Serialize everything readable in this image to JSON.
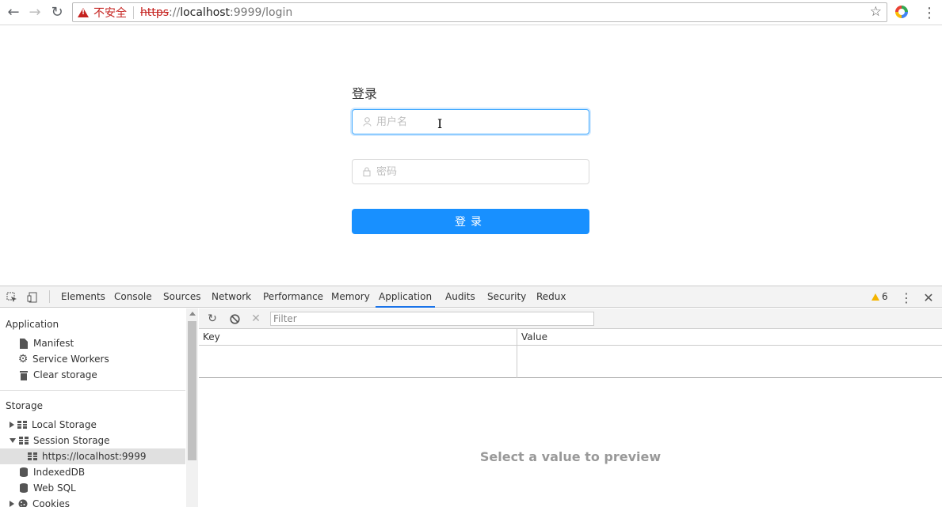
{
  "browser": {
    "security_label": "不安全",
    "url_scheme": "https",
    "url_sep": "://",
    "url_host": "localhost",
    "url_rest": ":9999/login"
  },
  "login": {
    "title": "登录",
    "username_placeholder": "用户名",
    "password_placeholder": "密码",
    "submit_label": "登录"
  },
  "devtools": {
    "tabs": [
      "Elements",
      "Console",
      "Sources",
      "Network",
      "Performance",
      "Memory",
      "Application",
      "Audits",
      "Security",
      "Redux"
    ],
    "active_tab": "Application",
    "warning_count": "6",
    "sidebar": {
      "application_section": "Application",
      "application_items": [
        "Manifest",
        "Service Workers",
        "Clear storage"
      ],
      "storage_section": "Storage",
      "storage_items": [
        "Local Storage",
        "Session Storage",
        "https://localhost:9999",
        "IndexedDB",
        "Web SQL",
        "Cookies"
      ]
    },
    "filter_placeholder": "Filter",
    "columns": [
      "Key",
      "Value"
    ],
    "preview_message": "Select a value to preview"
  },
  "colors": {
    "accent": "#1890ff",
    "insecure": "#c5221f",
    "devtools_active": "#1a73e8"
  }
}
